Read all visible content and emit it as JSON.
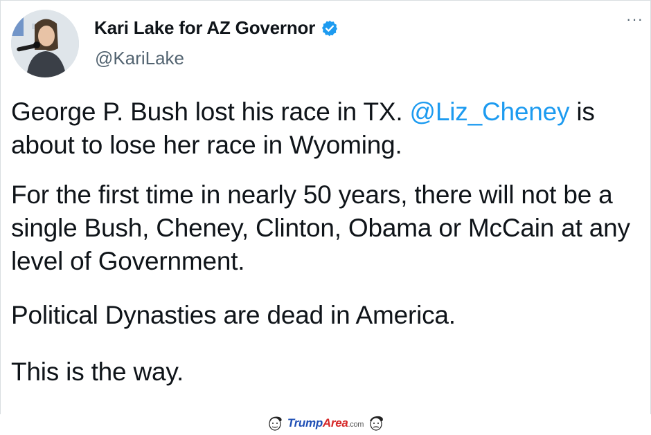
{
  "tweet": {
    "display_name": "Kari Lake for AZ Governor",
    "handle": "@KariLake",
    "more_label": "···",
    "paragraph_1_before": "George P. Bush lost his race in TX. ",
    "paragraph_1_mention": "@Liz_Cheney",
    "paragraph_1_after": " is about to lose her race in Wyoming.",
    "paragraph_2": "For the first time in nearly 50 years, there will not be a single Bush, Cheney, Clinton, Obama or McCain at any level of Government.",
    "paragraph_3": "Political Dynasties are dead in America.",
    "paragraph_4": "This is the way."
  },
  "watermark": {
    "brand_part_1": "Trump",
    "brand_part_2": "Area",
    "brand_part_3": ".com"
  },
  "colors": {
    "mention": "#1d9bf0",
    "verified": "#1d9bf0",
    "handle": "#536471",
    "brand_blue": "#1f4fb5",
    "brand_red": "#d62828"
  },
  "icons": {
    "verified": "verified-badge-icon",
    "more": "more-options-icon"
  }
}
